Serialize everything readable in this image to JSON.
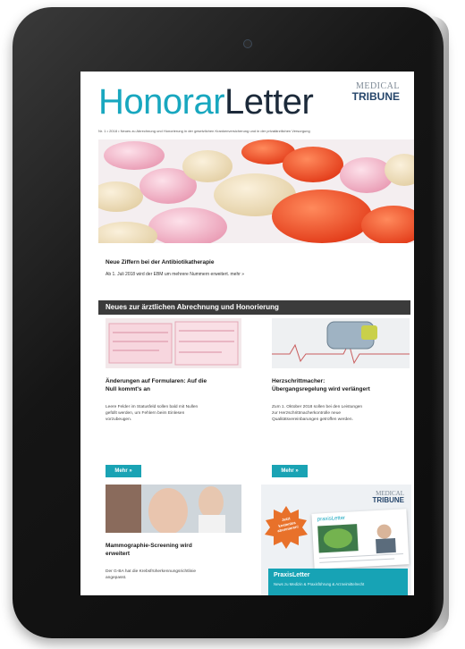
{
  "device": {
    "type": "tablet"
  },
  "newsletter": {
    "logo": {
      "part1": "Honorar",
      "part2": "Letter"
    },
    "publisher": {
      "line1": "MEDICAL",
      "line2": "TRIBUNE"
    },
    "issue_line": "Nr. 1 • 2018 • Neues zu Abrechnung und Honorierung in der gesetzlichen Krankenversicherung und in der privatärztlichen Versorgung"
  },
  "headline": {
    "title": "Neue Ziffern bei der Antibiotikatherapie",
    "text": "Ab 1. Juli 2018 wird der EBM um mehrere Nummern erweitert. mehr »"
  },
  "section": {
    "title": "Neues zur ärztlichen Abrechnung und Honorierung"
  },
  "articles": [
    {
      "title_line1": "Änderungen auf Formularen: Auf die",
      "title_line2": "Null kommt's an",
      "text_line1": "Leere Felder im Statusfeld sollen bald mit Nullen",
      "text_line2": "gefüllt werden, um Fehlern beim Einlesen",
      "text_line3": "vorzubeugen.",
      "button": "Mehr »",
      "image_icon": "medical-forms-image"
    },
    {
      "title_line1": "Herzschrittmacher:",
      "title_line2": "Übergangsregelung wird verlängert",
      "text_line1": "Zum 1. Oktober 2018 sollen bei den Leistungen",
      "text_line2": "zur Herzschrittmacherkontrolle neue",
      "text_line3": "Qualitätsvereinbarungen getroffen werden.",
      "button": "Mehr »",
      "image_icon": "pacemaker-image"
    },
    {
      "title_line1": "Mammographie-Screening wird",
      "title_line2": "erweitert",
      "text_line1": "Der G-BA hat die Krebsfrüherkennungsrichtlinie",
      "text_line2": "angepasst.",
      "image_icon": "mammography-image"
    }
  ],
  "promo": {
    "publisher_line1": "MEDICAL",
    "publisher_line2": "TRIBUNE",
    "badge": "Jetzt kostenlos abonnieren!",
    "doc_logo": "praxisLetter",
    "title": "PraxisLetter",
    "subtitle": "News zu Medizin & Praxisführung & Arzneimittelrecht"
  },
  "colors": {
    "accent": "#18a7bf",
    "dark_band": "#3b3b3b",
    "button": "#1aa3b4",
    "badge": "#e8712a"
  }
}
